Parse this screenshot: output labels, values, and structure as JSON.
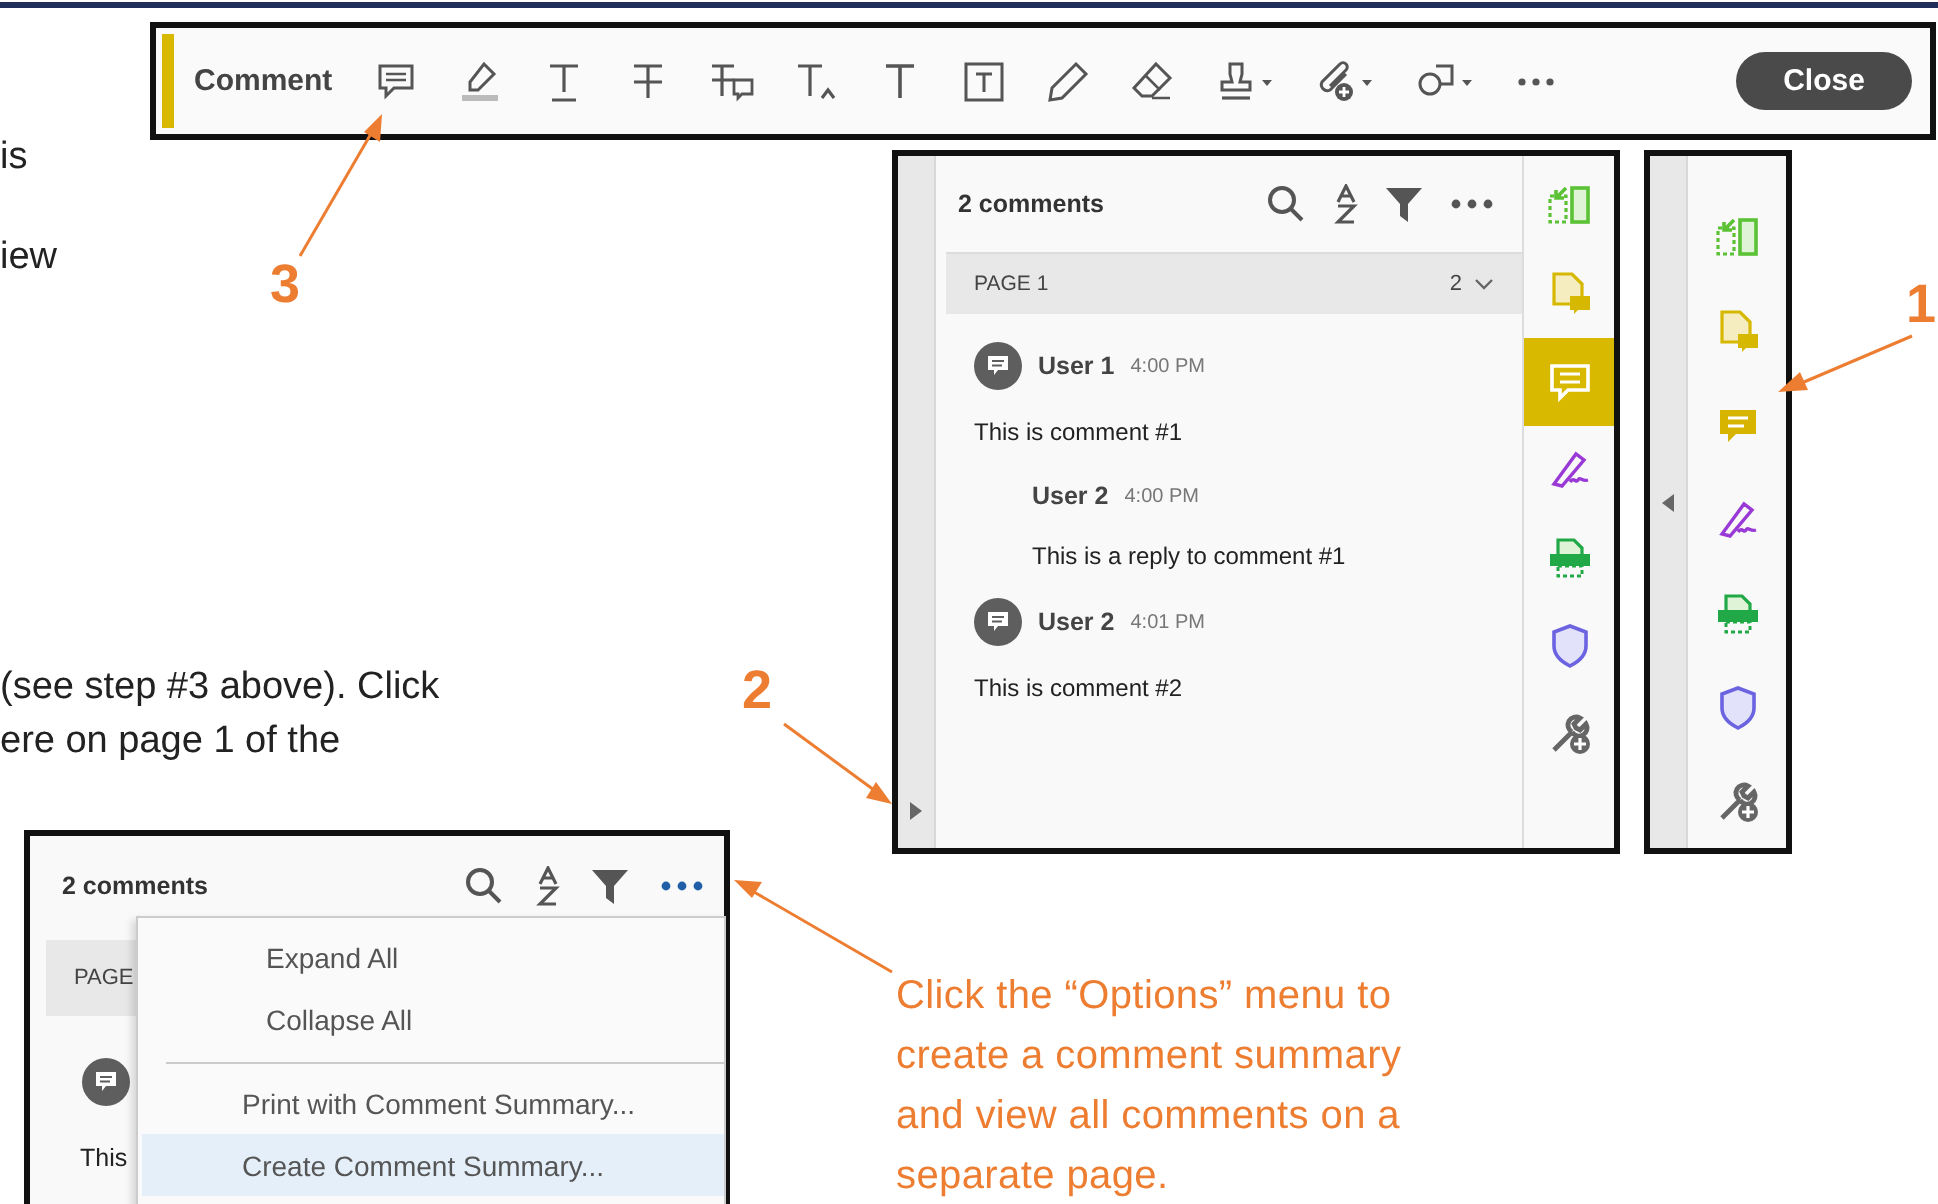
{
  "document_text": [
    "is",
    "iew",
    "(see step #3 above). Click",
    "ere on page 1 of the"
  ],
  "toolbar": {
    "title": "Comment",
    "close_button": "Close",
    "tools": [
      {
        "kind": "sticky-note",
        "dropdown": false
      },
      {
        "kind": "highlight",
        "dropdown": false
      },
      {
        "kind": "underline",
        "dropdown": false
      },
      {
        "kind": "strikethrough",
        "dropdown": false
      },
      {
        "kind": "replace-text",
        "dropdown": false
      },
      {
        "kind": "insert-text",
        "dropdown": false
      },
      {
        "kind": "add-text",
        "dropdown": false
      },
      {
        "kind": "text-box",
        "dropdown": false
      },
      {
        "kind": "pencil",
        "dropdown": false
      },
      {
        "kind": "eraser",
        "dropdown": false
      },
      {
        "kind": "stamp",
        "dropdown": true
      },
      {
        "kind": "attach",
        "dropdown": true
      },
      {
        "kind": "shapes",
        "dropdown": true
      },
      {
        "kind": "more",
        "dropdown": false
      }
    ]
  },
  "callouts": [
    {
      "number": "3"
    },
    {
      "number": "1"
    },
    {
      "number": "2"
    }
  ],
  "comments_panel": {
    "count_label": "2 comments",
    "page_label": "PAGE 1",
    "page_count": "2",
    "comments": [
      {
        "user": "User 1",
        "time": "4:00 PM",
        "text": "This is comment #1",
        "replies": [
          {
            "user": "User 2",
            "time": "4:00 PM",
            "text": "This is a reply to comment #1"
          }
        ]
      },
      {
        "user": "User 2",
        "time": "4:01 PM",
        "text": "This is comment #2"
      }
    ],
    "rail": [
      {
        "kind": "organize",
        "selected": false
      },
      {
        "kind": "export",
        "selected": false
      },
      {
        "kind": "comment",
        "selected": true
      },
      {
        "kind": "sign",
        "selected": false
      },
      {
        "kind": "scan",
        "selected": false
      },
      {
        "kind": "protect",
        "selected": false
      },
      {
        "kind": "more-tools",
        "selected": false
      }
    ]
  },
  "collapsed_panel": {
    "rail": [
      {
        "kind": "organize",
        "selected": false
      },
      {
        "kind": "export",
        "selected": false
      },
      {
        "kind": "comment",
        "selected": false
      },
      {
        "kind": "sign",
        "selected": false
      },
      {
        "kind": "scan",
        "selected": false
      },
      {
        "kind": "protect",
        "selected": false
      },
      {
        "kind": "more-tools",
        "selected": false
      }
    ]
  },
  "options_panel": {
    "count_label": "2 comments",
    "options_open": true,
    "page_label": "PAGE",
    "comment_text": "This",
    "menu_groups": [
      {
        "items": [
          {
            "label": "Expand All",
            "selected": false
          },
          {
            "label": "Collapse All",
            "selected": false
          }
        ]
      },
      {
        "items": [
          {
            "label": "Print with Comment Summary...",
            "selected": false
          },
          {
            "label": "Create Comment Summary...",
            "selected": true
          }
        ]
      }
    ]
  },
  "options_note": "Click the “Options” menu to create a comment summary and view all comments on a separate page."
}
